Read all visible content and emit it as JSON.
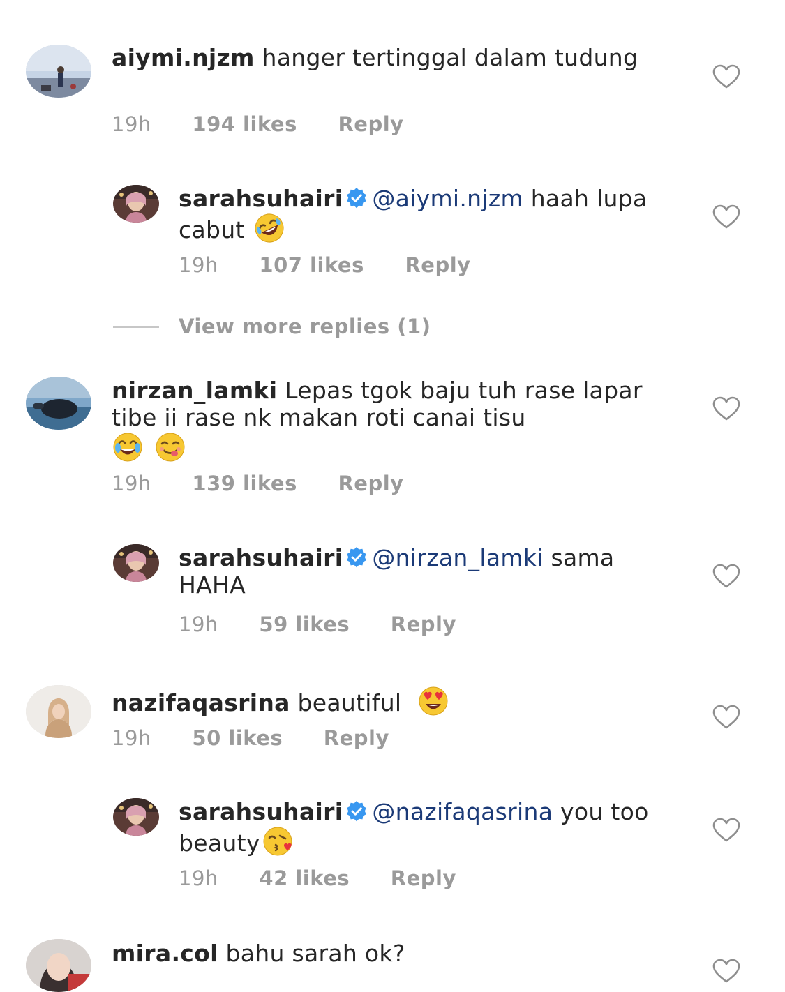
{
  "comments": [
    {
      "username": "aiymi.njzm",
      "text": "hanger tertinggal dalam tudung",
      "time": "19h",
      "likes": "194 likes",
      "reply": "Reply"
    },
    {
      "username": "sarahsuhairi",
      "verified": true,
      "mention": "@aiymi.njzm",
      "text": "haah lupa cabut",
      "emoji": [
        "rolling-on-floor-laughing"
      ],
      "time": "19h",
      "likes": "107 likes",
      "reply": "Reply"
    },
    {
      "username": "nirzan_lamki",
      "text": "Lepas tgok baju tuh rase lapar tibe ii rase nk makan roti canai tisu",
      "emoji": [
        "tears-of-joy",
        "face-savoring-food"
      ],
      "time": "19h",
      "likes": "139 likes",
      "reply": "Reply"
    },
    {
      "username": "sarahsuhairi",
      "verified": true,
      "mention": "@nirzan_lamki",
      "text": "sama HAHA",
      "time": "19h",
      "likes": "59 likes",
      "reply": "Reply"
    },
    {
      "username": "nazifaqasrina",
      "text": "beautiful",
      "emoji": [
        "heart-eyes"
      ],
      "time": "19h",
      "likes": "50 likes",
      "reply": "Reply"
    },
    {
      "username": "sarahsuhairi",
      "verified": true,
      "mention": "@nazifaqasrina",
      "text": "you too beauty",
      "emoji": [
        "face-blowing-kiss"
      ],
      "time": "19h",
      "likes": "42 likes",
      "reply": "Reply"
    },
    {
      "username": "mira.col",
      "text": "bahu sarah ok?"
    }
  ],
  "view_more": "View more replies (1)",
  "colors": {
    "username": "#262626",
    "mention": "#1b3a77",
    "meta": "#9a9a9a",
    "verified": "#3897f0"
  }
}
